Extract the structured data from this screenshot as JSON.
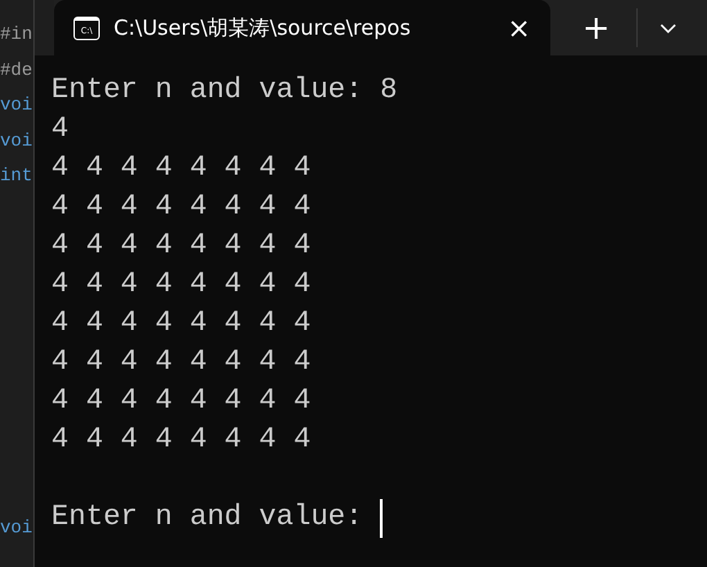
{
  "editor_behind": {
    "lines": [
      {
        "text": "#in",
        "kind": "directive"
      },
      {
        "text": "#de",
        "kind": "directive"
      },
      {
        "text": "voi",
        "kind": "keyword"
      },
      {
        "text": "voi",
        "kind": "keyword"
      },
      {
        "text": "int",
        "kind": "keyword"
      }
    ],
    "bottom_line": {
      "text": "voi",
      "kind": "keyword"
    }
  },
  "tab": {
    "icon_text": "C:\\",
    "title": "C:\\Users\\胡某涛\\source\\repos",
    "selected": true,
    "close": "×"
  },
  "new_tab": "+",
  "output_lines": [
    "Enter n and value: 8",
    "4",
    "4 4 4 4 4 4 4 4",
    "4 4 4 4 4 4 4 4",
    "4 4 4 4 4 4 4 4",
    "4 4 4 4 4 4 4 4",
    "4 4 4 4 4 4 4 4",
    "4 4 4 4 4 4 4 4",
    "4 4 4 4 4 4 4 4",
    "4 4 4 4 4 4 4 4"
  ],
  "prompt": {
    "text": "Enter n and value: ",
    "cursor": true
  }
}
